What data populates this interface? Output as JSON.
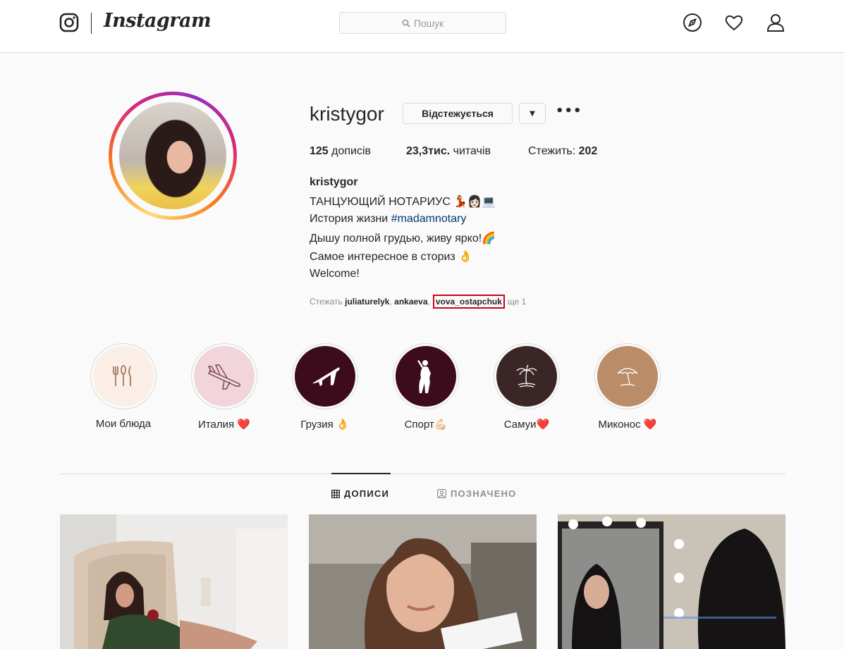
{
  "header": {
    "logo_text": "Instagram",
    "search_placeholder": "Пошук",
    "icons": [
      "instagram-glyph-icon",
      "explore-compass-icon",
      "activity-heart-icon",
      "profile-person-icon"
    ]
  },
  "profile": {
    "username": "kristygor",
    "follow_button": "Відстежується",
    "dropdown_glyph": "▼",
    "more_glyph": "•••",
    "stats": {
      "posts_count": "125",
      "posts_label": "дописів",
      "followers_count": "23,3тис.",
      "followers_label": "читачів",
      "following_label": "Стежить:",
      "following_count": "202"
    },
    "bio": {
      "name": "kristygor",
      "line1": "ТАНЦУЮЩИЙ НОТАРИУС 💃👩🏻💻",
      "line2_text": "История жизни ",
      "line2_hashtag": "#madamnotary",
      "line3": "Дышу полной грудью, живу ярко!🌈",
      "line4": "Самое интересное в сториз 👌",
      "line5": "Welcome!"
    },
    "followed_by": {
      "prefix": "Стежать",
      "user1": "juliaturelyk",
      "user2": "ankaeva",
      "user3": "vova_ostapchuk",
      "suffix": "ще 1"
    }
  },
  "highlights": [
    {
      "label": "Мои блюда",
      "icon": "cutlery-icon",
      "bg": "#fbeee6"
    },
    {
      "label": "Италия ❤️",
      "icon": "airplane-outline-icon",
      "bg": "#f1d5da"
    },
    {
      "label": "Грузия 👌",
      "icon": "airplane-icon",
      "bg": "#3d0c1c"
    },
    {
      "label": "Спорт💪🏻",
      "icon": "woman-silhouette-icon",
      "bg": "#3d0c1c"
    },
    {
      "label": "Самуи❤️",
      "icon": "palm-tree-icon",
      "bg": "#3a2626"
    },
    {
      "label": "Миконос ❤️",
      "icon": "beach-umbrella-icon",
      "bg": "#bb8c68"
    }
  ],
  "tabs": [
    {
      "label": "ДОПИСИ",
      "icon": "grid-icon",
      "active": true
    },
    {
      "label": "ПОЗНАЧЕНО",
      "icon": "tagged-icon",
      "active": false
    }
  ],
  "posts": [
    {
      "alt": "post-photo-1"
    },
    {
      "alt": "post-photo-2"
    },
    {
      "alt": "post-photo-3"
    }
  ],
  "colors": {
    "accent_link": "#00376b",
    "highlight_box": "#d0021b",
    "border": "#dbdbdb"
  }
}
